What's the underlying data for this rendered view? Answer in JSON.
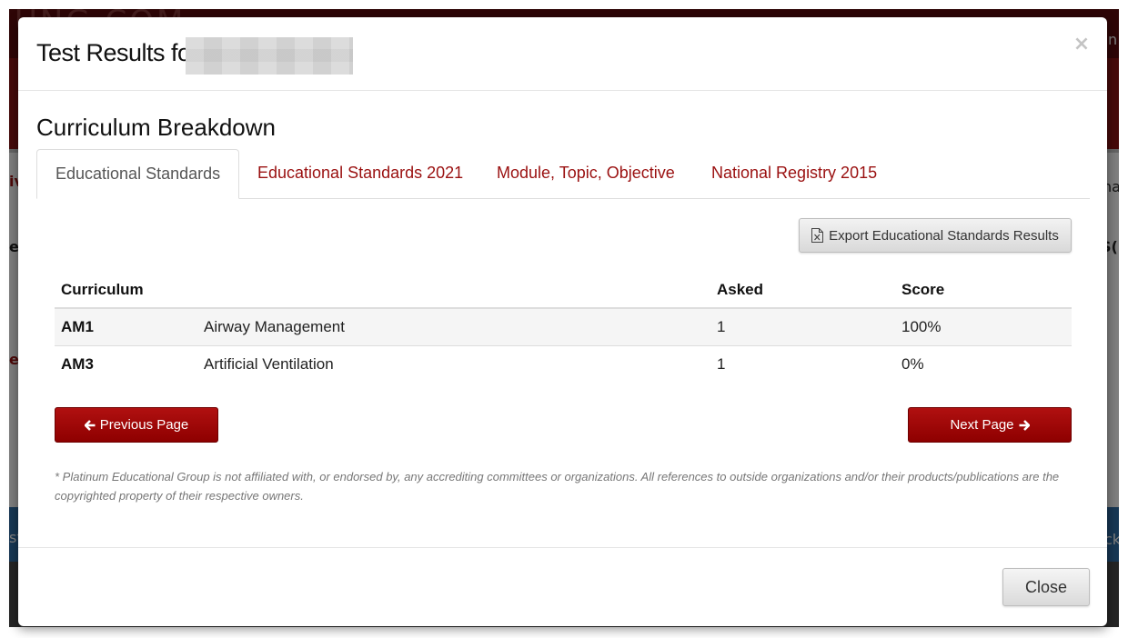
{
  "background": {
    "logo_text": "UNG.COM",
    "edge_left": [
      "iv",
      "er",
      "e",
      "st"
    ],
    "edge_right": [
      "n",
      "na",
      "S(",
      "ck"
    ]
  },
  "modal": {
    "title_prefix": "Test Results for",
    "close_glyph": "×",
    "section_title": "Curriculum Breakdown",
    "tabs": [
      {
        "label": "Educational Standards",
        "active": true
      },
      {
        "label": "Educational Standards 2021",
        "active": false
      },
      {
        "label": "Module, Topic, Objective",
        "active": false
      },
      {
        "label": "National Registry 2015",
        "active": false
      }
    ],
    "export_button": {
      "label": "Export Educational Standards Results",
      "icon": "excel-file-icon"
    },
    "table": {
      "headers": {
        "curriculum": "Curriculum",
        "name": "",
        "asked": "Asked",
        "score": "Score"
      },
      "rows": [
        {
          "code": "AM1",
          "name": "Airway Management",
          "asked": "1",
          "score": "100%"
        },
        {
          "code": "AM3",
          "name": "Artificial Ventilation",
          "asked": "1",
          "score": "0%"
        }
      ]
    },
    "prev_button": {
      "label": "Previous Page",
      "icon": "arrow-left-icon"
    },
    "next_button": {
      "label": "Next Page",
      "icon": "arrow-right-icon"
    },
    "disclaimer": "* Platinum Educational Group is not affiliated with, or endorsed by, any accrediting committees or organizations. All references to outside organizations and/or their products/publications are the copyrighted property of their respective owners.",
    "footer": {
      "close_label": "Close"
    }
  },
  "colors": {
    "accent_red": "#9a1010",
    "button_red": "#a00808"
  }
}
